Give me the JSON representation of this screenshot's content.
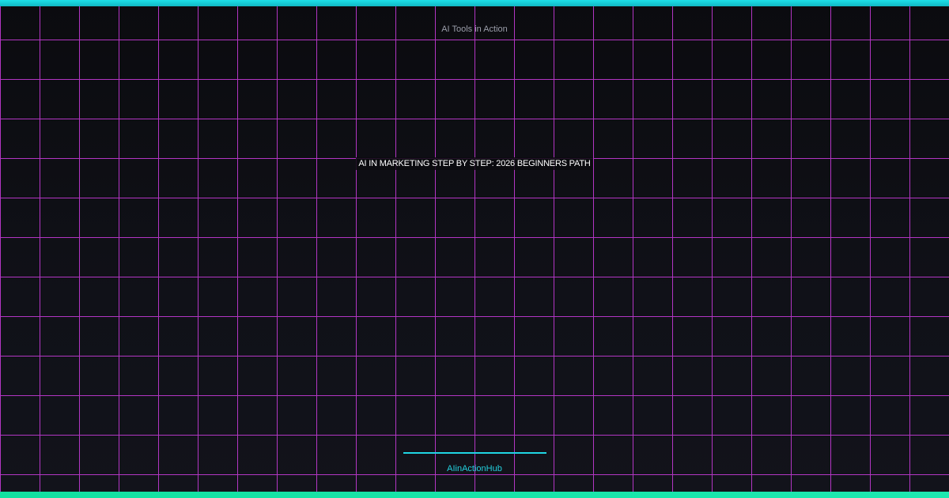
{
  "brand": {
    "top_label": "AI Tools in Action",
    "handle": "AIinActionHub"
  },
  "headline": {
    "text": "AI IN MARKETING STEP BY STEP: 2026 BEGINNERS PATH"
  },
  "colors": {
    "background": "#0c0c10",
    "grid_lines": "#c43ad6",
    "top_accent": "#1de0e8",
    "bottom_accent": "#12e0a0",
    "handle_text": "#23d0dd"
  }
}
